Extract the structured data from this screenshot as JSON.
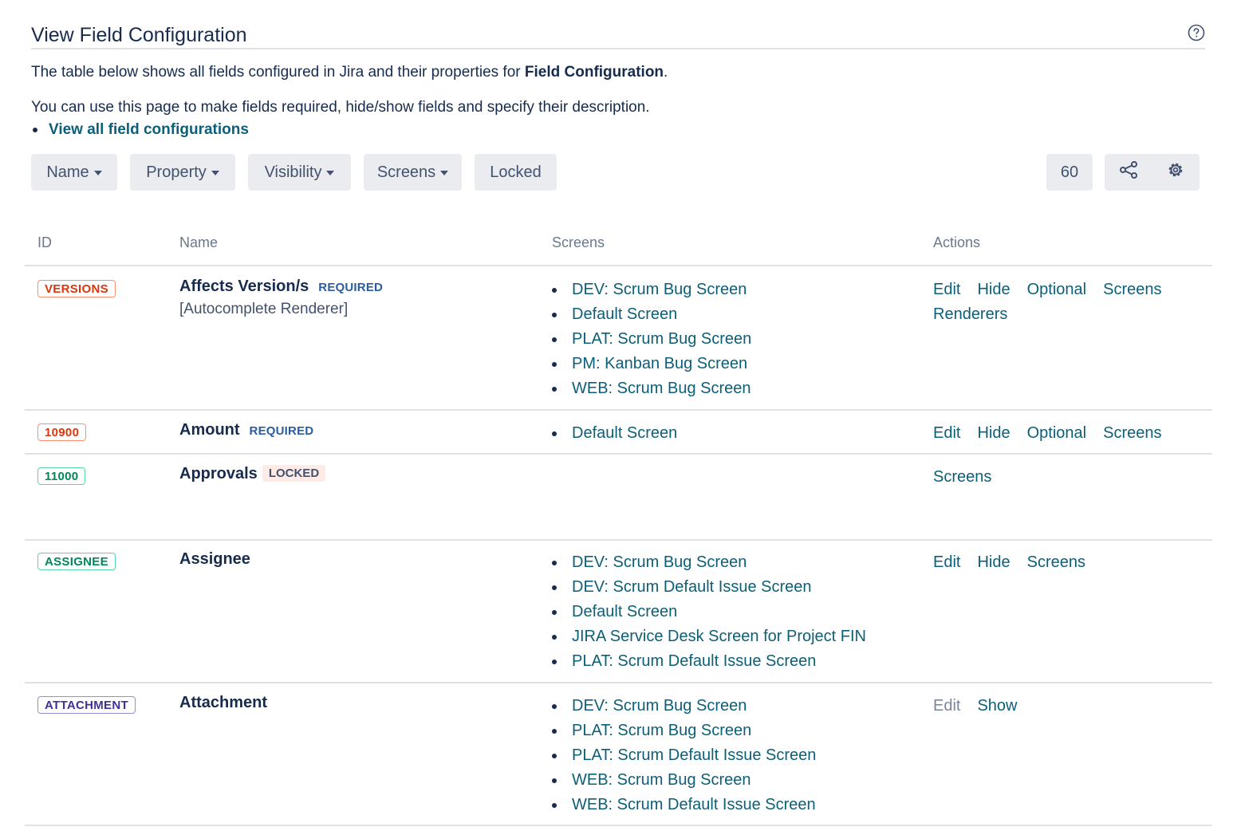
{
  "header": {
    "title": "View Field Configuration",
    "help_icon": "question-circle-icon"
  },
  "intro": {
    "line1_prefix": "The table below shows all fields configured in Jira and their properties for ",
    "line1_bold": "Field Configuration",
    "line1_suffix": ".",
    "line2": "You can use this page to make fields required, hide/show fields and specify their description.",
    "view_all_link": "View all field configurations"
  },
  "toolbar": {
    "filters": [
      "Name",
      "Property",
      "Visibility",
      "Screens",
      "Locked"
    ],
    "page_size": "60",
    "share_icon": "share-icon",
    "settings_icon": "gear-icon"
  },
  "table": {
    "columns": [
      "ID",
      "Name",
      "Screens",
      "Actions"
    ],
    "rows": [
      {
        "id": "VERSIONS",
        "id_color": "#de350b",
        "name": "Affects Version/s",
        "status": "REQUIRED",
        "renderer": "[Autocomplete Renderer]",
        "screens": [
          "DEV: Scrum Bug Screen",
          "Default Screen",
          "PLAT: Scrum Bug Screen",
          "PM: Kanban Bug Screen",
          "WEB: Scrum Bug Screen"
        ],
        "actions": [
          "Edit",
          "Hide",
          "Optional",
          "Screens",
          "Renderers"
        ]
      },
      {
        "id": "10900",
        "id_color": "#de350b",
        "name": "Amount",
        "status": "REQUIRED",
        "screens": [
          "Default Screen"
        ],
        "actions": [
          "Edit",
          "Hide",
          "Optional",
          "Screens"
        ]
      },
      {
        "id": "11000",
        "id_color": "#00875a",
        "name": "Approvals",
        "locked": "LOCKED",
        "screens": [],
        "actions": [
          "Screens"
        ]
      },
      {
        "id": "ASSIGNEE",
        "id_color": "#00875a",
        "name": "Assignee",
        "screens": [
          "DEV: Scrum Bug Screen",
          "DEV: Scrum Default Issue Screen",
          "Default Screen",
          "JIRA Service Desk Screen for Project FIN",
          "PLAT: Scrum Default Issue Screen"
        ],
        "actions": [
          "Edit",
          "Hide",
          "Screens"
        ]
      },
      {
        "id": "ATTACHMENT",
        "id_color": "#403294",
        "name": "Attachment",
        "screens": [
          "DEV: Scrum Bug Screen",
          "PLAT: Scrum Bug Screen",
          "PLAT: Scrum Default Issue Screen",
          "WEB: Scrum Bug Screen",
          "WEB: Scrum Default Issue Screen"
        ],
        "actions": [
          "Edit",
          "Show"
        ],
        "disabled_actions": [
          "Edit"
        ]
      }
    ]
  }
}
